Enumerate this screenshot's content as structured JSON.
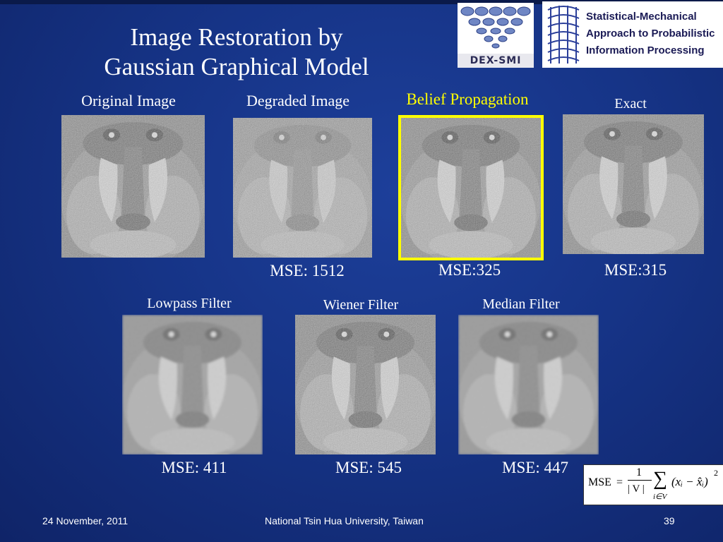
{
  "slide": {
    "title_line1": "Image Restoration by",
    "title_line2": "Gaussian Graphical Model"
  },
  "logos": {
    "dex_smi": "DEX-SMI",
    "smapip_lines": [
      "Statistical-Mechanical",
      "Approach to Probabilistic",
      "Information Processing"
    ]
  },
  "panels_top": [
    {
      "caption": "Original Image",
      "mse": ""
    },
    {
      "caption": "Degraded Image",
      "mse": "MSE: 1512"
    },
    {
      "caption": "Belief Propagation",
      "mse": "MSE:325"
    },
    {
      "caption": "Exact",
      "mse": "MSE:315"
    }
  ],
  "panels_bottom": [
    {
      "caption": "Lowpass Filter",
      "mse": "MSE: 411"
    },
    {
      "caption": "Wiener Filter",
      "mse": "MSE: 545"
    },
    {
      "caption": "Median Filter",
      "mse": "MSE: 447"
    }
  ],
  "formula": {
    "lhs": "MSE",
    "equals": "=",
    "numerator": "1",
    "denominator": "| V |",
    "sigma": "∑",
    "subscript": "i∈V",
    "body": "(xᵢ − x̂ᵢ)",
    "power": "2"
  },
  "footer": {
    "date": "24 November, 2011",
    "institution": "National Tsin Hua University, Taiwan",
    "page": "39"
  },
  "colors": {
    "background": "#163487",
    "highlight_caption": "#ffff00",
    "highlight_frame": "#ffff00",
    "text": "#ffffff"
  },
  "icons": {
    "image_placeholder": "mandrill-image"
  }
}
